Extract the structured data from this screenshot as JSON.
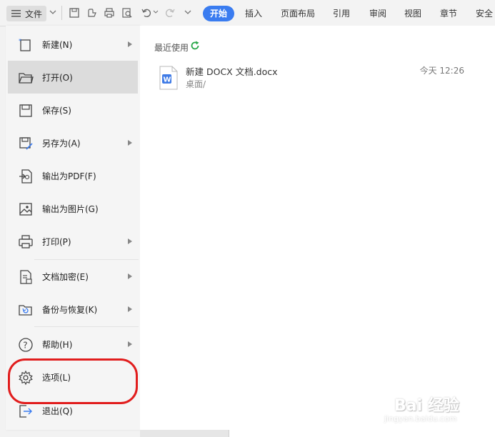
{
  "toolbar": {
    "file_label": "文件",
    "tabs": [
      "开始",
      "插入",
      "页面布局",
      "引用",
      "审阅",
      "视图",
      "章节",
      "安全"
    ]
  },
  "menu": {
    "items": [
      {
        "label": "新建(N)",
        "icon": "new-doc-icon",
        "submenu": true
      },
      {
        "label": "打开(O)",
        "icon": "folder-open-icon",
        "submenu": false
      },
      {
        "label": "保存(S)",
        "icon": "save-icon",
        "submenu": false
      },
      {
        "label": "另存为(A)",
        "icon": "save-as-icon",
        "submenu": true
      },
      {
        "label": "输出为PDF(F)",
        "icon": "export-pdf-icon",
        "submenu": false
      },
      {
        "label": "输出为图片(G)",
        "icon": "export-image-icon",
        "submenu": true
      },
      {
        "label": "打印(P)",
        "icon": "printer-icon",
        "submenu": true
      },
      {
        "label": "文档加密(E)",
        "icon": "encrypt-doc-icon",
        "submenu": true
      },
      {
        "label": "备份与恢复(K)",
        "icon": "backup-restore-icon",
        "submenu": true
      },
      {
        "label": "帮助(H)",
        "icon": "help-icon",
        "submenu": true
      },
      {
        "label": "选项(L)",
        "icon": "gear-icon",
        "submenu": false
      },
      {
        "label": "退出(Q)",
        "icon": "exit-icon",
        "submenu": false
      }
    ]
  },
  "recent": {
    "title": "最近使用",
    "files": [
      {
        "name": "新建 DOCX 文档.docx",
        "path": "桌面/",
        "time": "今天 12:26"
      }
    ]
  },
  "watermark": {
    "text": "Bai 经验",
    "sub": "jingyan.baidu.com"
  },
  "colors": {
    "accent": "#3a7cf0",
    "highlight": "#e11d1d",
    "refresh": "#2aa84a",
    "doc_icon": "#3f7be6"
  }
}
